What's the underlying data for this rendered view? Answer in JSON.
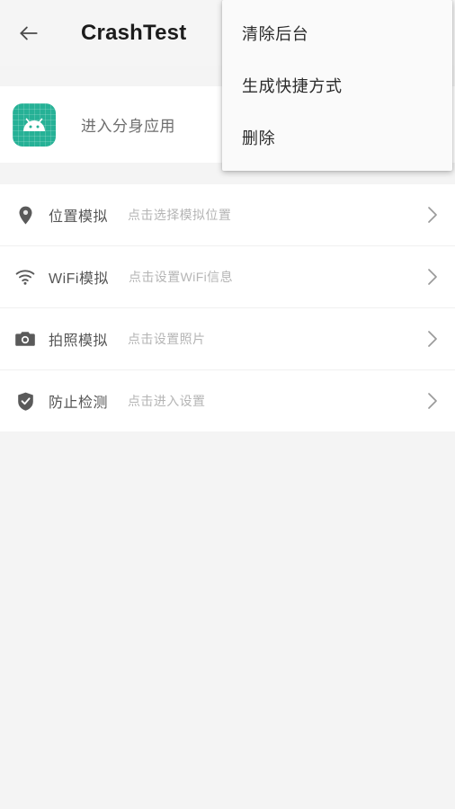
{
  "toolbar": {
    "back_icon": "arrow-left-icon",
    "title": "CrashTest"
  },
  "app_card": {
    "icon": "android-app-icon",
    "label": "进入分身应用"
  },
  "settings_list": {
    "rows": [
      {
        "icon": "location-pin-icon",
        "title": "位置模拟",
        "subtitle": "点击选择模拟位置",
        "chevron": "chevron-right-icon"
      },
      {
        "icon": "wifi-icon",
        "title": "WiFi模拟",
        "subtitle": "点击设置WiFi信息",
        "chevron": "chevron-right-icon"
      },
      {
        "icon": "camera-icon",
        "title": "拍照模拟",
        "subtitle": "点击设置照片",
        "chevron": "chevron-right-icon"
      },
      {
        "icon": "shield-check-icon",
        "title": "防止检测",
        "subtitle": "点击进入设置",
        "chevron": "chevron-right-icon"
      }
    ]
  },
  "overflow_menu": {
    "items": [
      {
        "label": "清除后台"
      },
      {
        "label": "生成快捷方式"
      },
      {
        "label": "删除"
      }
    ]
  },
  "colors": {
    "toolbar_bg": "#f5f5f5",
    "page_bg": "#f4f4f4",
    "card_bg": "#ffffff",
    "menu_bg": "#fafafa",
    "app_icon_accent": "#26b196",
    "title_text": "#1c1c1c",
    "row_title_text": "#555555",
    "row_subtitle_text": "#b5b5b5"
  }
}
